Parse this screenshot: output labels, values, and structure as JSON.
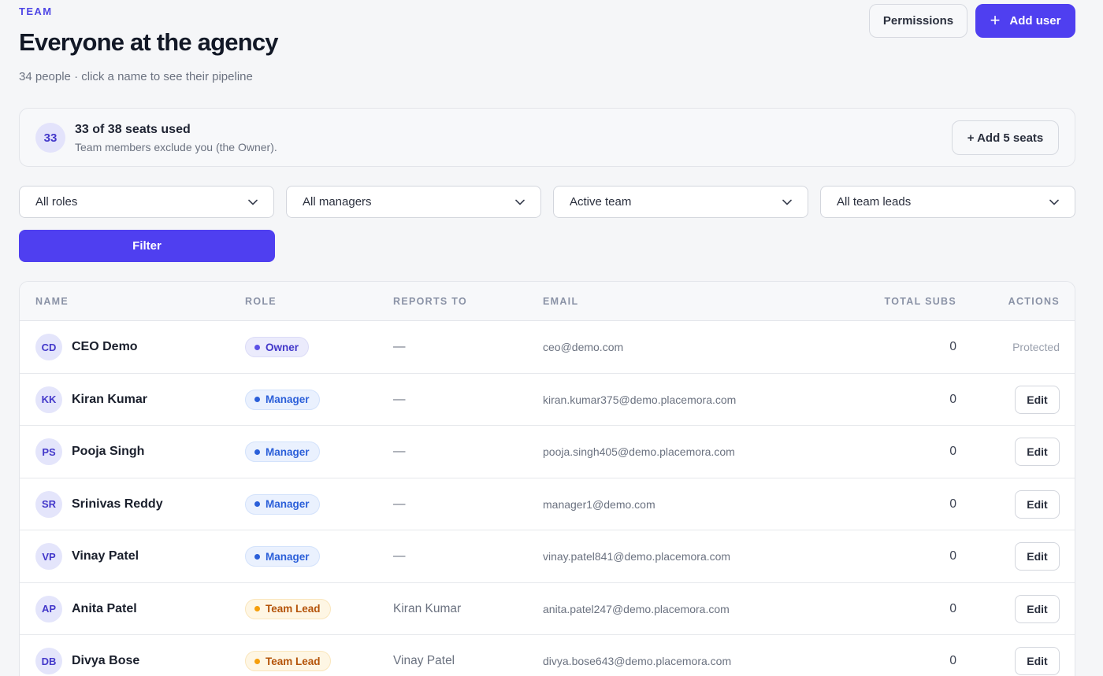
{
  "header": {
    "eyebrow": "TEAM",
    "title": "Everyone at the agency",
    "subtitle": "34 people · click a name to see their pipeline",
    "permissions_label": "Permissions",
    "add_user_label": "Add user"
  },
  "seats": {
    "count": "33",
    "title": "33 of 38 seats used",
    "note": "Team members exclude you (the Owner).",
    "add_label": "+ Add 5 seats"
  },
  "filters": {
    "roles": "All roles",
    "managers": "All managers",
    "team": "Active team",
    "team_leads": "All team leads",
    "filter_label": "Filter"
  },
  "table": {
    "columns": [
      "NAME",
      "ROLE",
      "REPORTS TO",
      "EMAIL",
      "TOTAL SUBS",
      "ACTIONS"
    ],
    "role_styles": {
      "Owner": {
        "bg": "#ebebfc",
        "border": "#dcdcf7",
        "color": "#4338ca",
        "dot": "#5b50e6"
      },
      "Manager": {
        "bg": "#eaf1fe",
        "border": "#d3e2fb",
        "color": "#2b5fd9",
        "dot": "#2b5fd9"
      },
      "Team Lead": {
        "bg": "#fef6e4",
        "border": "#fae6bc",
        "color": "#b45309",
        "dot": "#f59e0b"
      }
    },
    "rows": [
      {
        "initials": "CD",
        "name": "CEO Demo",
        "role": "Owner",
        "reports_to": "—",
        "email": "ceo@demo.com",
        "subs": "0",
        "action": "Protected"
      },
      {
        "initials": "KK",
        "name": "Kiran Kumar",
        "role": "Manager",
        "reports_to": "—",
        "email": "kiran.kumar375@demo.placemora.com",
        "subs": "0",
        "action": "Edit"
      },
      {
        "initials": "PS",
        "name": "Pooja Singh",
        "role": "Manager",
        "reports_to": "—",
        "email": "pooja.singh405@demo.placemora.com",
        "subs": "0",
        "action": "Edit"
      },
      {
        "initials": "SR",
        "name": "Srinivas Reddy",
        "role": "Manager",
        "reports_to": "—",
        "email": "manager1@demo.com",
        "subs": "0",
        "action": "Edit"
      },
      {
        "initials": "VP",
        "name": "Vinay Patel",
        "role": "Manager",
        "reports_to": "—",
        "email": "vinay.patel841@demo.placemora.com",
        "subs": "0",
        "action": "Edit"
      },
      {
        "initials": "AP",
        "name": "Anita Patel",
        "role": "Team Lead",
        "reports_to": "Kiran Kumar",
        "email": "anita.patel247@demo.placemora.com",
        "subs": "0",
        "action": "Edit"
      },
      {
        "initials": "DB",
        "name": "Divya Bose",
        "role": "Team Lead",
        "reports_to": "Vinay Patel",
        "email": "divya.bose643@demo.placemora.com",
        "subs": "0",
        "action": "Edit"
      }
    ]
  }
}
